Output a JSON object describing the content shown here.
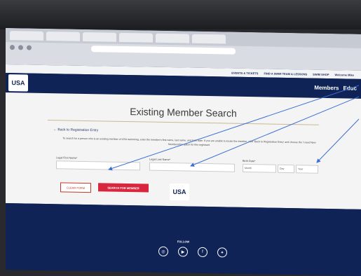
{
  "browser": {
    "tabs": [
      "",
      "",
      "",
      "",
      "",
      ""
    ],
    "url": "",
    "bookmarks": [
      "",
      "",
      "",
      "",
      "",
      "",
      "",
      "",
      "",
      ""
    ]
  },
  "utility_nav": {
    "items": [
      "EVENTS & TICKETS",
      "FIND A SWIM TEAM & LESSONS",
      "SWIM SHOP",
      "Welcome Mike"
    ]
  },
  "main_nav": {
    "logo": "USA",
    "links": [
      "Members",
      "Educ"
    ]
  },
  "page": {
    "title": "Existing Member Search",
    "back_link": "← Back to Registration Entry",
    "instructions": "To search for a person who is an existing member of USA swimming, enter the member's first name, last name, and birth date. If you are unable to locate the member, click 'Back to Registration Entry' and choose the 'I need New Membership' option for this registrant.",
    "first_name_label": "Legal First Name*",
    "last_name_label": "Legal Last Name*",
    "birth_label": "Birth Date*",
    "month_value": "Month",
    "day_value": "Day",
    "year_value": "Year",
    "clear_button": "CLEAR FORM",
    "search_button": "SEARCH FOR MEMBER"
  },
  "footer": {
    "logo": "USA",
    "follow": "FOLLOW",
    "social_icons": [
      "instagram-icon",
      "youtube-icon",
      "facebook-icon",
      "twitter-icon"
    ],
    "social_glyphs": [
      "◎",
      "▶",
      "f",
      "✦"
    ]
  },
  "annotations": {
    "arrow_color": "#3b6fd6"
  }
}
